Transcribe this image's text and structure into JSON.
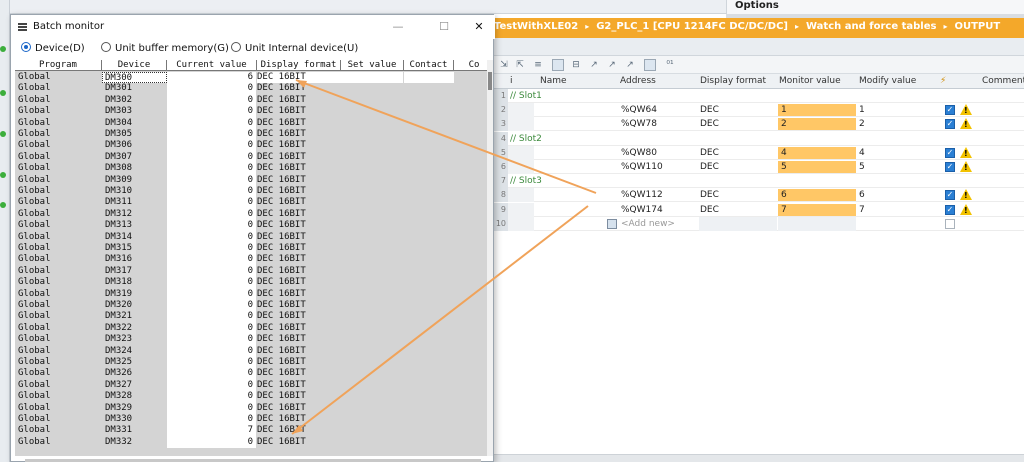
{
  "tia": {
    "options_title": "Options",
    "breadcrumb": [
      "TestWithXLE02",
      "G2_PLC_1 [CPU 1214FC DC/DC/DC]",
      "Watch and force tables",
      "OUTPUT"
    ],
    "breadcrumb_sep": "▸",
    "table_headers": {
      "info": "i",
      "name": "Name",
      "address": "Address",
      "display_format": "Display format",
      "monitor_value": "Monitor value",
      "modify_value": "Modify value",
      "force": "⚡",
      "comment": "Comment"
    },
    "rows": [
      {
        "num": "1",
        "group": "// Slot1"
      },
      {
        "num": "2",
        "address": "%QW64",
        "format": "DEC",
        "monitor": "1",
        "modify": "1"
      },
      {
        "num": "3",
        "address": "%QW78",
        "format": "DEC",
        "monitor": "2",
        "modify": "2"
      },
      {
        "num": "4",
        "group": "// Slot2"
      },
      {
        "num": "5",
        "address": "%QW80",
        "format": "DEC",
        "monitor": "4",
        "modify": "4"
      },
      {
        "num": "6",
        "address": "%QW110",
        "format": "DEC",
        "monitor": "5",
        "modify": "5"
      },
      {
        "num": "7",
        "group": "// Slot3"
      },
      {
        "num": "8",
        "address": "%QW112",
        "format": "DEC",
        "monitor": "6",
        "modify": "6"
      },
      {
        "num": "9",
        "address": "%QW174",
        "format": "DEC",
        "monitor": "7",
        "modify": "7"
      },
      {
        "num": "10",
        "addnew": "<Add new>"
      }
    ],
    "colors": {
      "accent": "#f4a82a",
      "monitor_fill": "#ffc766"
    }
  },
  "dialog": {
    "title": "Batch monitor",
    "minimize": "—",
    "maximize": "☐",
    "close": "✕",
    "radio_device": "Device(D)",
    "radio_buffer": "Unit buffer memory(G)",
    "radio_internal": "Unit Internal device(U)",
    "headers": {
      "program": "Program",
      "device": "Device",
      "current_value": "Current value",
      "display_format": "Display format",
      "set_value": "Set value",
      "contact": "Contact",
      "co": "Co"
    },
    "rows": [
      {
        "program": "Global",
        "device": "DM300",
        "value": "6",
        "format": "DEC 16BIT"
      },
      {
        "program": "Global",
        "device": "DM301",
        "value": "0",
        "format": "DEC 16BIT"
      },
      {
        "program": "Global",
        "device": "DM302",
        "value": "0",
        "format": "DEC 16BIT"
      },
      {
        "program": "Global",
        "device": "DM303",
        "value": "0",
        "format": "DEC 16BIT"
      },
      {
        "program": "Global",
        "device": "DM304",
        "value": "0",
        "format": "DEC 16BIT"
      },
      {
        "program": "Global",
        "device": "DM305",
        "value": "0",
        "format": "DEC 16BIT"
      },
      {
        "program": "Global",
        "device": "DM306",
        "value": "0",
        "format": "DEC 16BIT"
      },
      {
        "program": "Global",
        "device": "DM307",
        "value": "0",
        "format": "DEC 16BIT"
      },
      {
        "program": "Global",
        "device": "DM308",
        "value": "0",
        "format": "DEC 16BIT"
      },
      {
        "program": "Global",
        "device": "DM309",
        "value": "0",
        "format": "DEC 16BIT"
      },
      {
        "program": "Global",
        "device": "DM310",
        "value": "0",
        "format": "DEC 16BIT"
      },
      {
        "program": "Global",
        "device": "DM311",
        "value": "0",
        "format": "DEC 16BIT"
      },
      {
        "program": "Global",
        "device": "DM312",
        "value": "0",
        "format": "DEC 16BIT"
      },
      {
        "program": "Global",
        "device": "DM313",
        "value": "0",
        "format": "DEC 16BIT"
      },
      {
        "program": "Global",
        "device": "DM314",
        "value": "0",
        "format": "DEC 16BIT"
      },
      {
        "program": "Global",
        "device": "DM315",
        "value": "0",
        "format": "DEC 16BIT"
      },
      {
        "program": "Global",
        "device": "DM316",
        "value": "0",
        "format": "DEC 16BIT"
      },
      {
        "program": "Global",
        "device": "DM317",
        "value": "0",
        "format": "DEC 16BIT"
      },
      {
        "program": "Global",
        "device": "DM318",
        "value": "0",
        "format": "DEC 16BIT"
      },
      {
        "program": "Global",
        "device": "DM319",
        "value": "0",
        "format": "DEC 16BIT"
      },
      {
        "program": "Global",
        "device": "DM320",
        "value": "0",
        "format": "DEC 16BIT"
      },
      {
        "program": "Global",
        "device": "DM321",
        "value": "0",
        "format": "DEC 16BIT"
      },
      {
        "program": "Global",
        "device": "DM322",
        "value": "0",
        "format": "DEC 16BIT"
      },
      {
        "program": "Global",
        "device": "DM323",
        "value": "0",
        "format": "DEC 16BIT"
      },
      {
        "program": "Global",
        "device": "DM324",
        "value": "0",
        "format": "DEC 16BIT"
      },
      {
        "program": "Global",
        "device": "DM325",
        "value": "0",
        "format": "DEC 16BIT"
      },
      {
        "program": "Global",
        "device": "DM326",
        "value": "0",
        "format": "DEC 16BIT"
      },
      {
        "program": "Global",
        "device": "DM327",
        "value": "0",
        "format": "DEC 16BIT"
      },
      {
        "program": "Global",
        "device": "DM328",
        "value": "0",
        "format": "DEC 16BIT"
      },
      {
        "program": "Global",
        "device": "DM329",
        "value": "0",
        "format": "DEC 16BIT"
      },
      {
        "program": "Global",
        "device": "DM330",
        "value": "0",
        "format": "DEC 16BIT"
      },
      {
        "program": "Global",
        "device": "DM331",
        "value": "7",
        "format": "DEC 16BIT"
      },
      {
        "program": "Global",
        "device": "DM332",
        "value": "0",
        "format": "DEC 16BIT"
      }
    ],
    "colors": {
      "arrow": "#f0a35a",
      "grid_bg": "#d4d4d4"
    }
  }
}
